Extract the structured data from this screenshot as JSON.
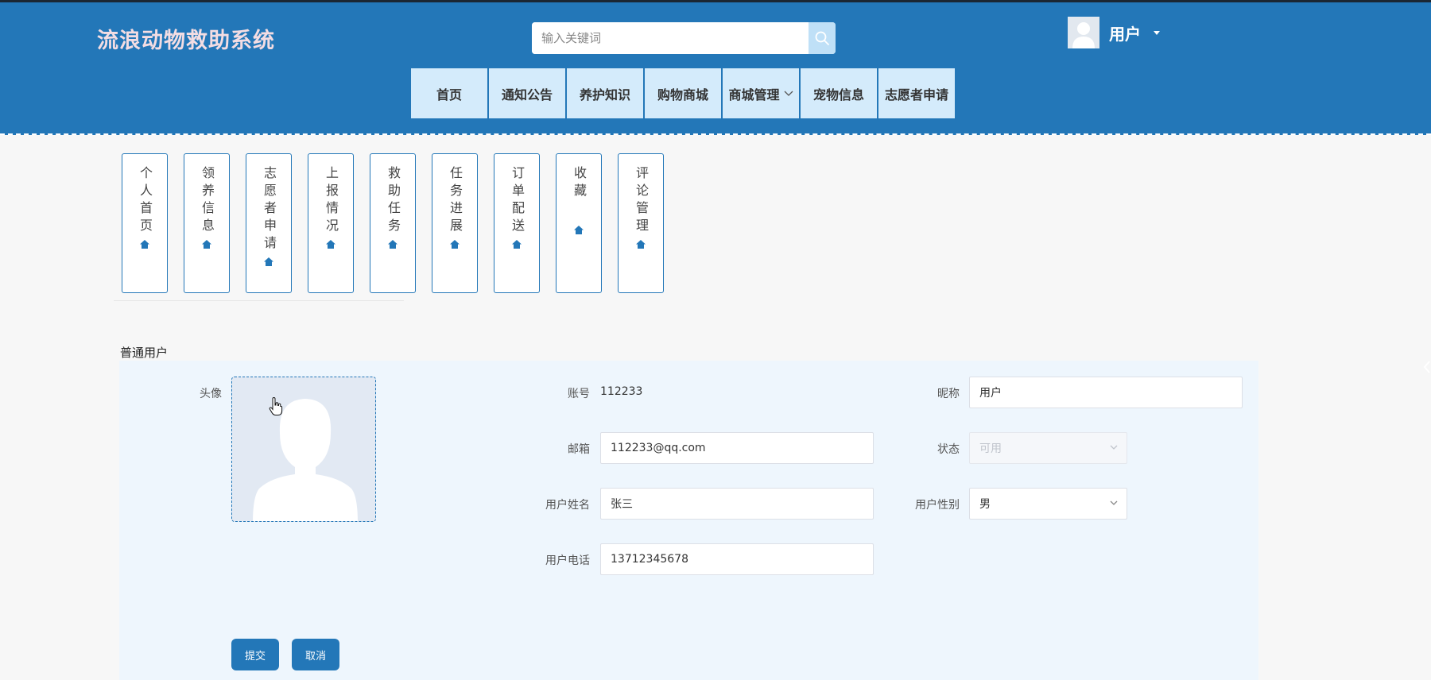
{
  "header": {
    "site_title": "流浪动物救助系统",
    "search_placeholder": "输入关键词",
    "user_name": "用户"
  },
  "nav": [
    {
      "label": "首页"
    },
    {
      "label": "通知公告"
    },
    {
      "label": "养护知识"
    },
    {
      "label": "购物商城"
    },
    {
      "label": "商城管理",
      "has_dropdown": true
    },
    {
      "label": "宠物信息"
    },
    {
      "label": "志愿者申请"
    }
  ],
  "side_menu": [
    {
      "label": "个人首页",
      "icon": "home-icon"
    },
    {
      "label": "领养信息",
      "icon": "home-icon"
    },
    {
      "label": "志愿者申请",
      "icon": "home-icon"
    },
    {
      "label": "上报情况",
      "icon": "home-icon"
    },
    {
      "label": "救助任务",
      "icon": "home-icon"
    },
    {
      "label": "任务进展",
      "icon": "home-icon"
    },
    {
      "label": "订单配送",
      "icon": "home-icon"
    },
    {
      "label": "收藏",
      "icon": "home-icon"
    },
    {
      "label": "评论管理",
      "icon": "home-icon"
    }
  ],
  "form": {
    "section_title": "普通用户",
    "avatar_label": "头像",
    "account_label": "账号",
    "account_value": "112233",
    "nickname_label": "昵称",
    "nickname_value": "用户",
    "email_label": "邮箱",
    "email_value": "112233@qq.com",
    "status_label": "状态",
    "status_value": "可用",
    "realname_label": "用户姓名",
    "realname_value": "张三",
    "gender_label": "用户性别",
    "gender_value": "男",
    "phone_label": "用户电话",
    "phone_value": "13712345678",
    "submit_label": "提交",
    "cancel_label": "取消"
  },
  "colors": {
    "header_bg": "#2377b8",
    "nav_item_bg": "#d4ebfb",
    "panel_bg": "#eef6fd",
    "title_color": "#f3dde3"
  }
}
